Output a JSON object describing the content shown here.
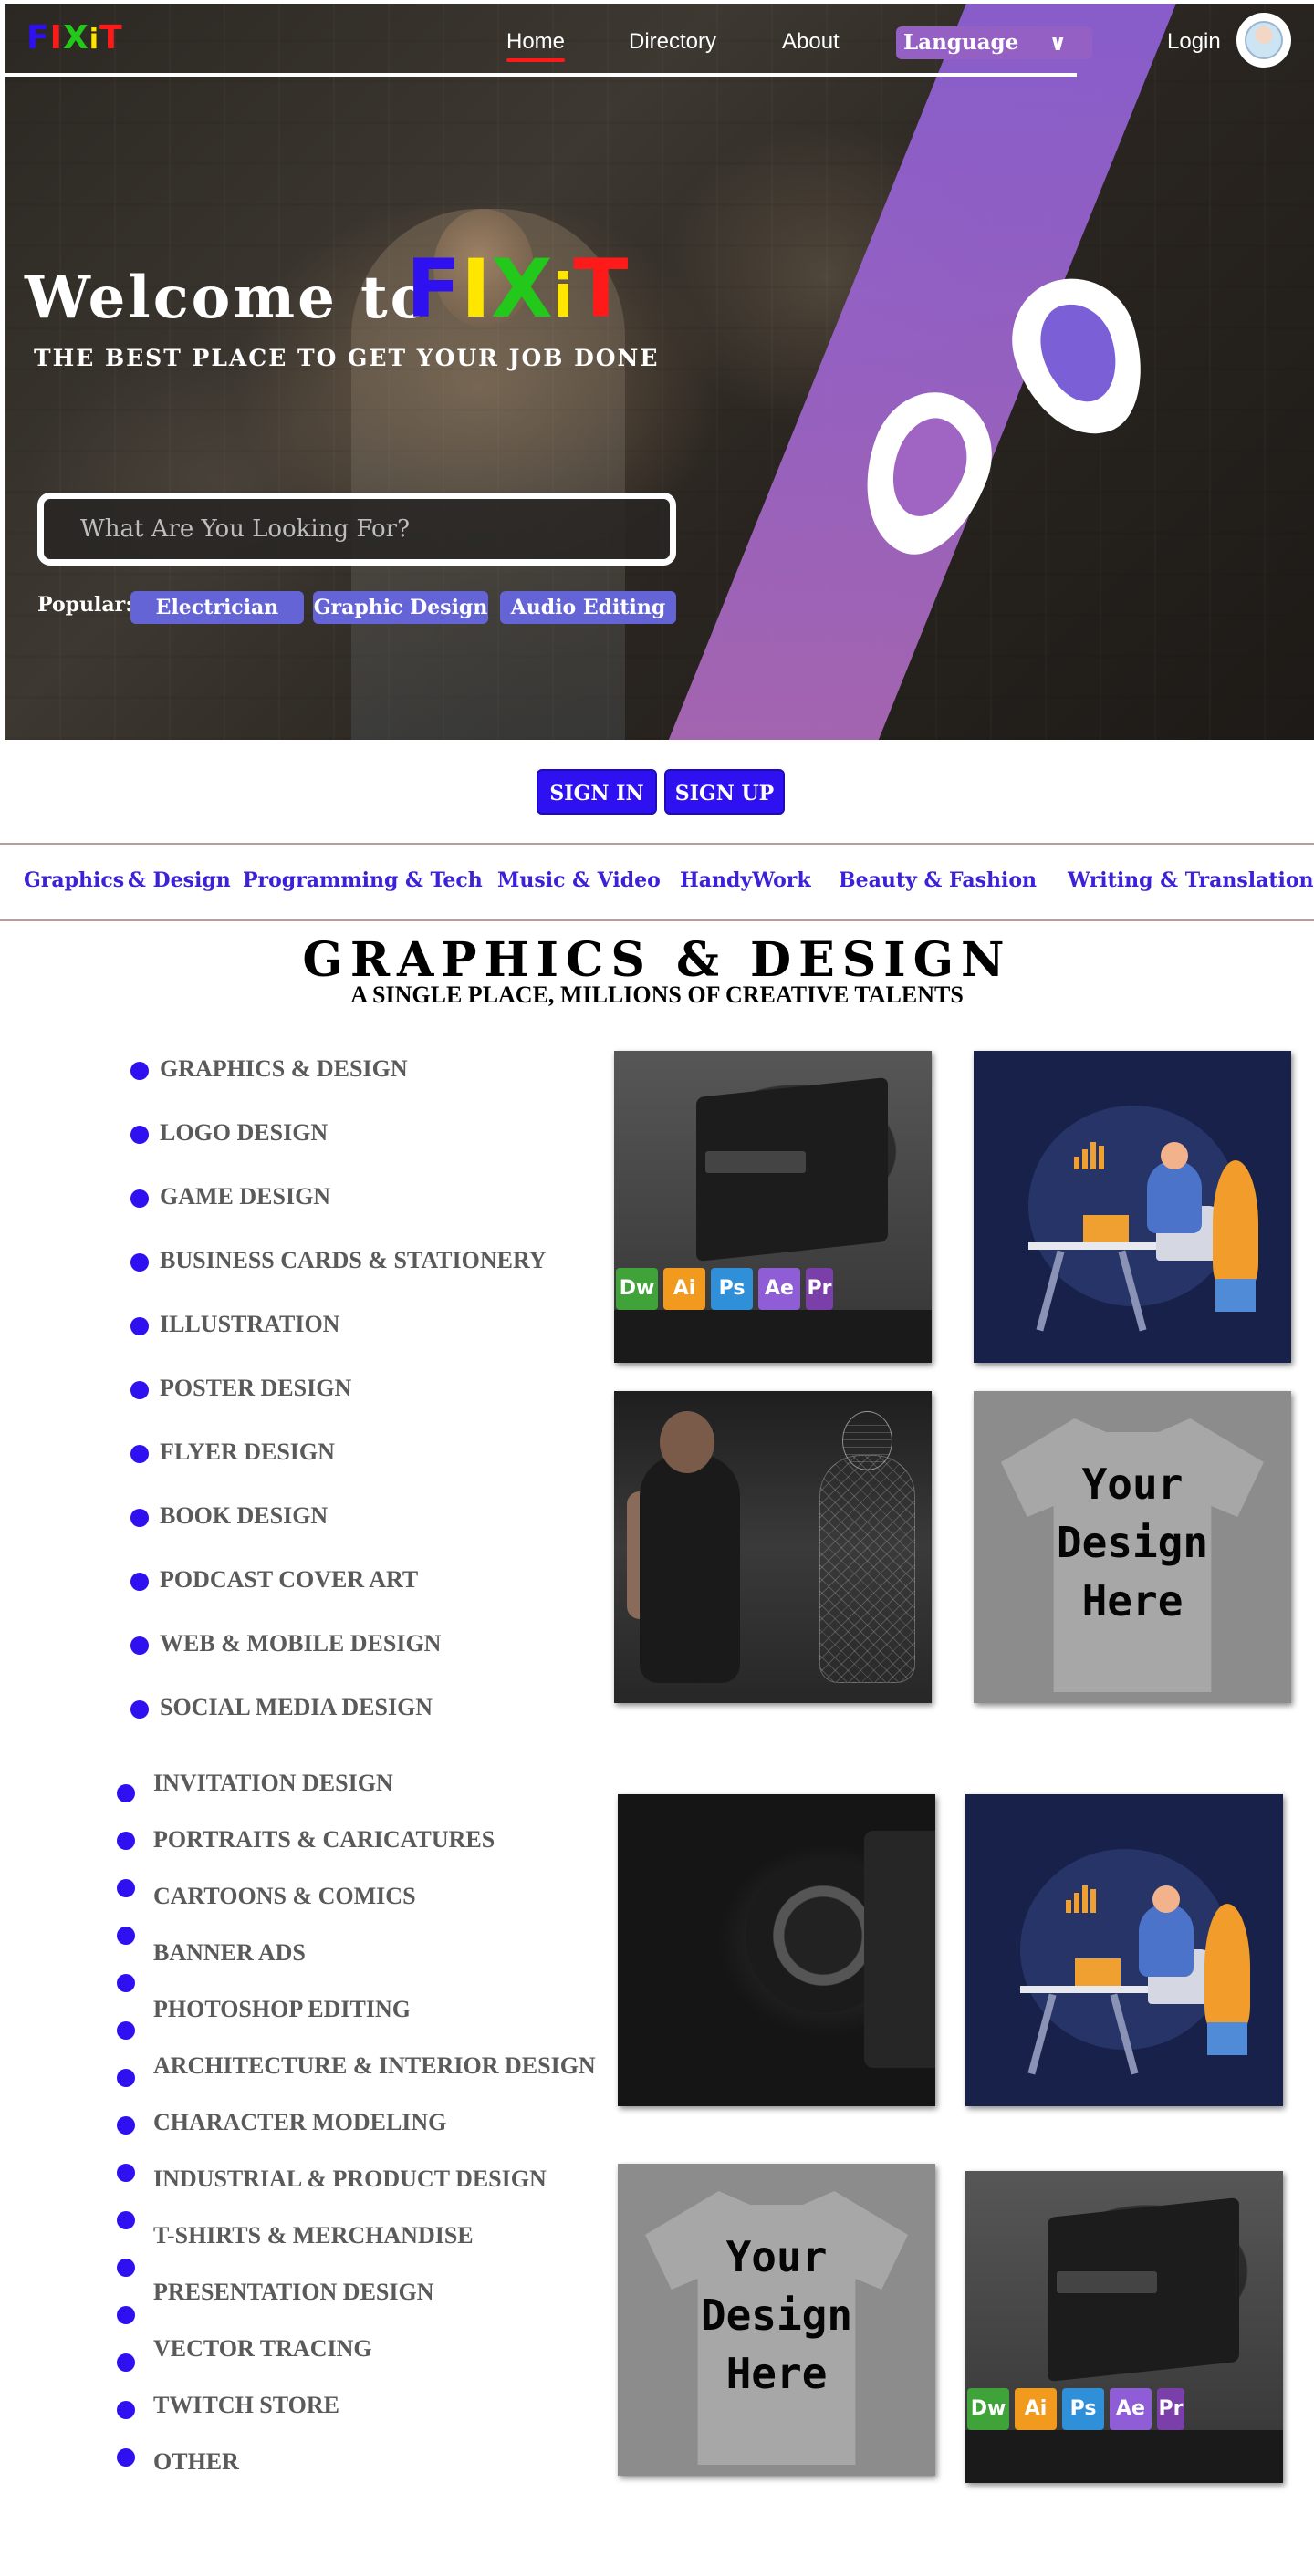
{
  "nav": {
    "logo": [
      "F",
      "I",
      "X",
      "i",
      "T"
    ],
    "logo_colors": [
      "#2e10f0",
      "#ff1a1a",
      "#22c81a",
      "#ffe600",
      "#ff1a1a"
    ],
    "links": [
      "Home",
      "Directory",
      "About"
    ],
    "language": "Language",
    "login": "Login"
  },
  "hero": {
    "welcome": "Welcome to",
    "brand": [
      "F",
      "I",
      "X",
      "i",
      "T"
    ],
    "brand_colors": [
      "#2e10f0",
      "#ffe600",
      "#22c81a",
      "#ffe600",
      "#ff1a1a"
    ],
    "tagline": "THE BEST PLACE TO GET YOUR JOB DONE",
    "search_placeholder": "What Are You Looking For?",
    "popular_label": "Popular:",
    "popular": [
      "Electrician",
      "Graphic Design",
      "Audio Editing"
    ]
  },
  "auth": {
    "sign_in": "SIGN IN",
    "sign_up": "SIGN UP"
  },
  "categories": [
    "Graphics",
    "& Design",
    "Programming & Tech",
    "Music & Video",
    "HandyWork",
    "Beauty & Fashion",
    "Writing & Translation"
  ],
  "section": {
    "title": "GRAPHICS & DESIGN",
    "subtitle": "A SINGLE PLACE, MILLIONS OF CREATIVE TALENTS",
    "list_a": [
      "GRAPHICS & DESIGN",
      "LOGO DESIGN",
      "GAME DESIGN",
      "BUSINESS CARDS & STATIONERY",
      "ILLUSTRATION",
      "POSTER DESIGN",
      "FLYER DESIGN",
      "BOOK DESIGN",
      "PODCAST COVER ART",
      "WEB & MOBILE DESIGN",
      "SOCIAL MEDIA DESIGN"
    ],
    "list_b": [
      "INVITATION DESIGN",
      "PORTRAITS & CARICATURES",
      "CARTOONS & COMICS",
      "BANNER ADS",
      "PHOTOSHOP EDITING",
      "ARCHITECTURE & INTERIOR DESIGN",
      "CHARACTER MODELING",
      "INDUSTRIAL & PRODUCT DESIGN",
      "T-SHIRTS & MERCHANDISE",
      "PRESENTATION DESIGN",
      "VECTOR TRACING",
      "TWITCH STORE",
      "OTHER"
    ]
  },
  "tiles": {
    "apps": [
      "Dw",
      "Ai",
      "Ps",
      "Ae",
      "Pr"
    ],
    "app_colors": [
      "#3fa33a",
      "#f29a1e",
      "#2f8fd8",
      "#8f5ed6",
      "#7a3fa8"
    ],
    "shirt_text": "Your\nDesign\nHere"
  },
  "colors": {
    "accent": "#2e10f0",
    "chip": "#6464d6",
    "band": "#9a63c8"
  }
}
